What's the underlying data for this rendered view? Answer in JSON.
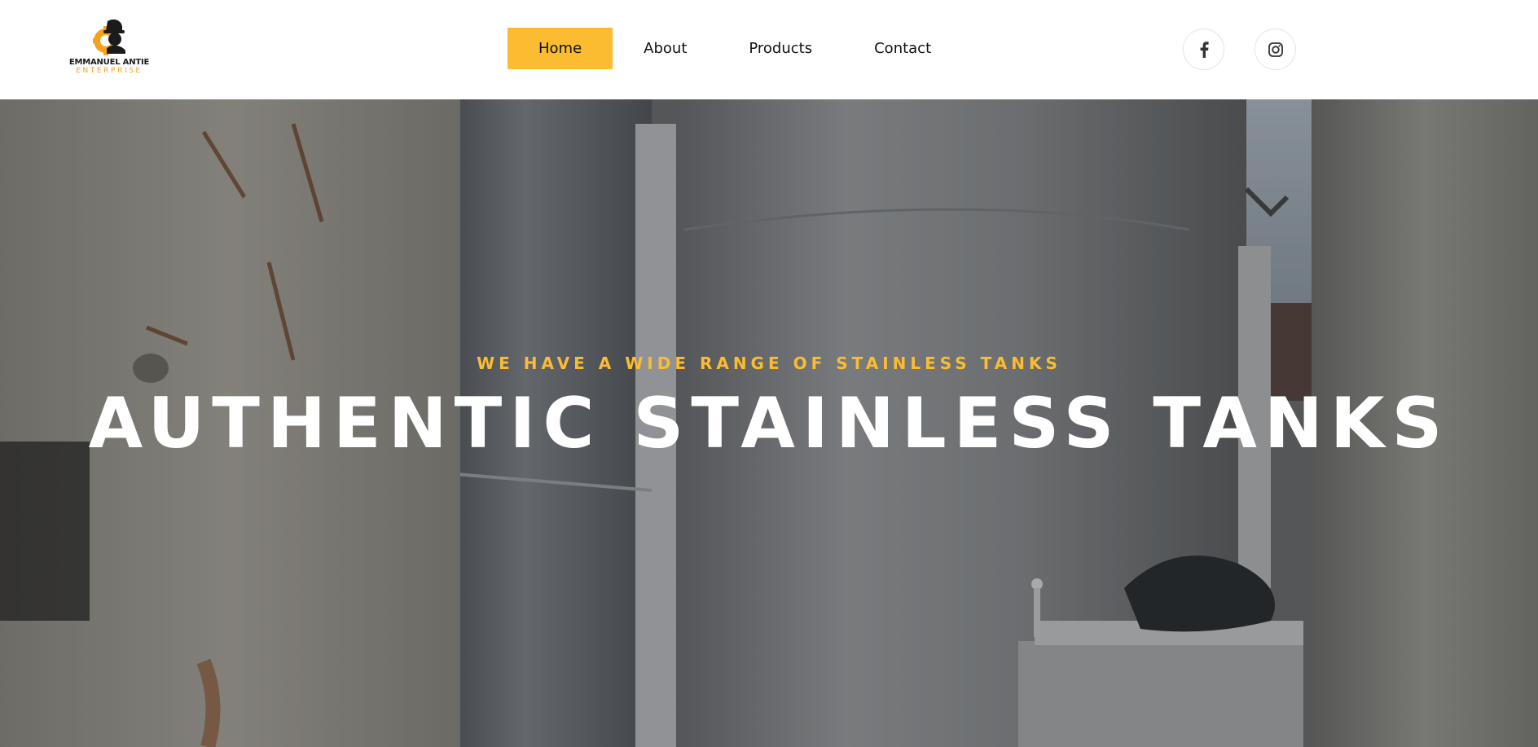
{
  "brand": {
    "name_line1": "EMMANUEL ANTIE",
    "name_line2": "ENTERPRISE",
    "logo_icon": "worker-gear-icon",
    "colors": {
      "accent": "#fbbc32",
      "logo_orange": "#f7a21b",
      "dark": "#1b1b1b"
    }
  },
  "nav": {
    "items": [
      {
        "label": "Home",
        "active": true
      },
      {
        "label": "About",
        "active": false
      },
      {
        "label": "Products",
        "active": false
      },
      {
        "label": "Contact",
        "active": false
      }
    ]
  },
  "social": [
    {
      "icon": "facebook-icon"
    },
    {
      "icon": "instagram-icon"
    }
  ],
  "hero": {
    "subtitle": "WE HAVE A WIDE RANGE OF STAINLESS TANKS",
    "title": "AUTHENTIC STAINLESS TANKS",
    "background": "stainless-steel-tanks-photo"
  }
}
